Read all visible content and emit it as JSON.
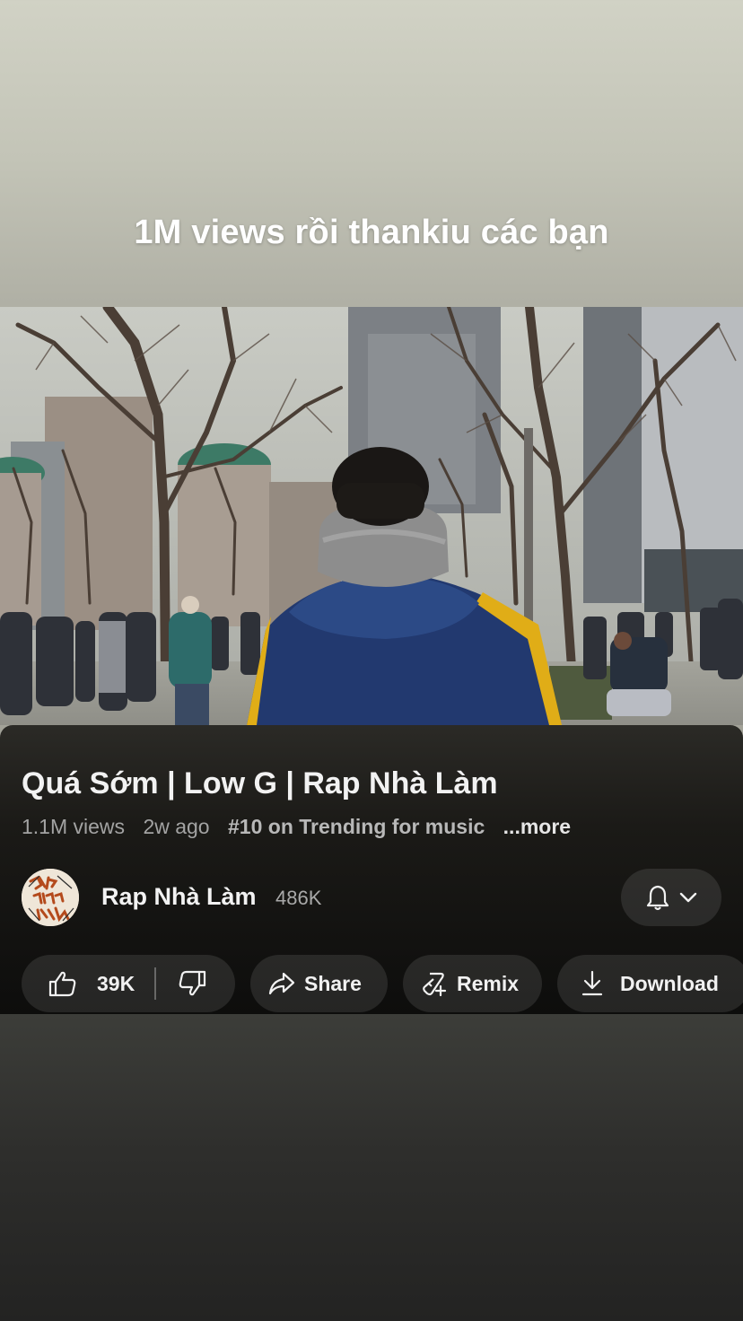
{
  "story": {
    "caption": "1M views rồi thankiu các bạn"
  },
  "video": {
    "title": "Quá Sớm | Low G | Rap Nhà Làm",
    "views": "1.1M views",
    "age": "2w ago",
    "trending": "#10 on Trending for music",
    "more_label": "...more"
  },
  "channel": {
    "name": "Rap Nhà Làm",
    "subscribers": "486K",
    "avatar_text": "RAP NHÀ LÀM"
  },
  "actions": {
    "like_count": "39K",
    "share_label": "Share",
    "remix_label": "Remix",
    "download_label": "Download"
  },
  "icons": {
    "like": "thumbs-up-icon",
    "dislike": "thumbs-down-icon",
    "share": "share-arrow-icon",
    "remix": "remix-icon",
    "download": "download-icon",
    "bell": "bell-icon",
    "chevron": "chevron-down-icon"
  },
  "colors": {
    "panel_bg": "#0d0d0c",
    "pill_bg": "#2a2a28",
    "text_primary": "#f2f2f2",
    "text_secondary": "#a3a3a3",
    "jacket_navy": "#223b78",
    "jacket_stripe": "#e6b417"
  }
}
